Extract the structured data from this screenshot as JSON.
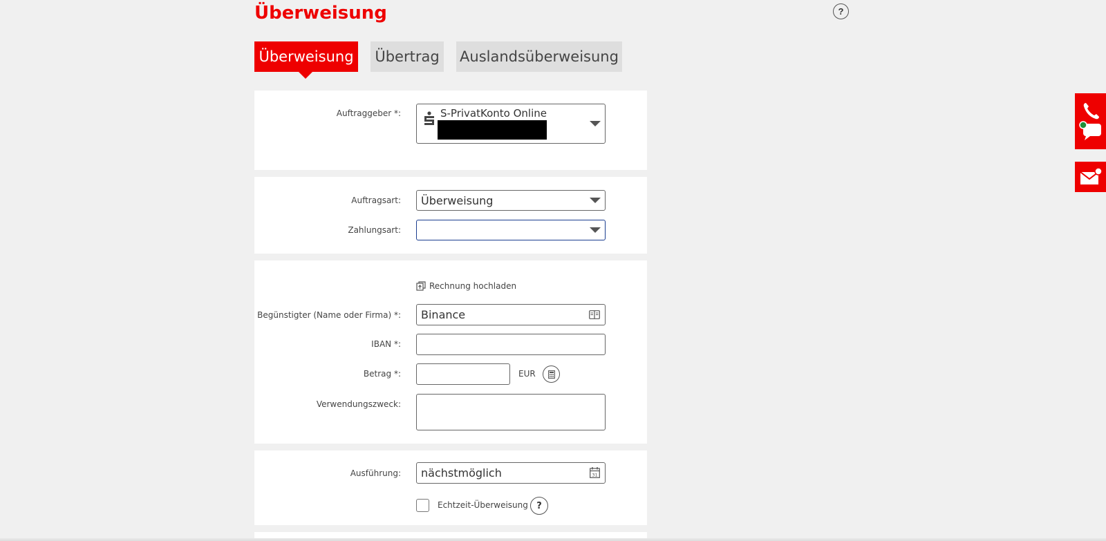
{
  "header": {
    "title": "Überweisung",
    "help_label": "?"
  },
  "tabs": [
    {
      "label": "Überweisung",
      "active": true
    },
    {
      "label": "Übertrag",
      "active": false
    },
    {
      "label": "Auslandsüberweisung",
      "active": false
    }
  ],
  "auftraggeber": {
    "label": "Auftraggeber *:",
    "account_name": "S-PrivatKonto Online"
  },
  "auftrag": {
    "auftragsart_label": "Auftragsart:",
    "auftragsart_value": "Überweisung",
    "zahlungsart_label": "Zahlungsart:",
    "zahlungsart_value": ""
  },
  "empfaenger": {
    "upload_label": "Rechnung hochladen",
    "beguenstigter_label": "Begünstigter (Name oder Firma) *:",
    "beguenstigter_value": "Binance",
    "iban_label": "IBAN *:",
    "iban_value": "",
    "betrag_label": "Betrag *:",
    "betrag_value": "",
    "currency": "EUR",
    "verwendungszweck_label": "Verwendungszweck:",
    "verwendungszweck_value": ""
  },
  "ausfuehrung": {
    "label": "Ausführung:",
    "value": "nächstmöglich",
    "echtzeit_label": "Echtzeit-Überweisung",
    "help_label": "?"
  },
  "colors": {
    "brand": "#ee0000",
    "focus": "#1a3d8f"
  }
}
